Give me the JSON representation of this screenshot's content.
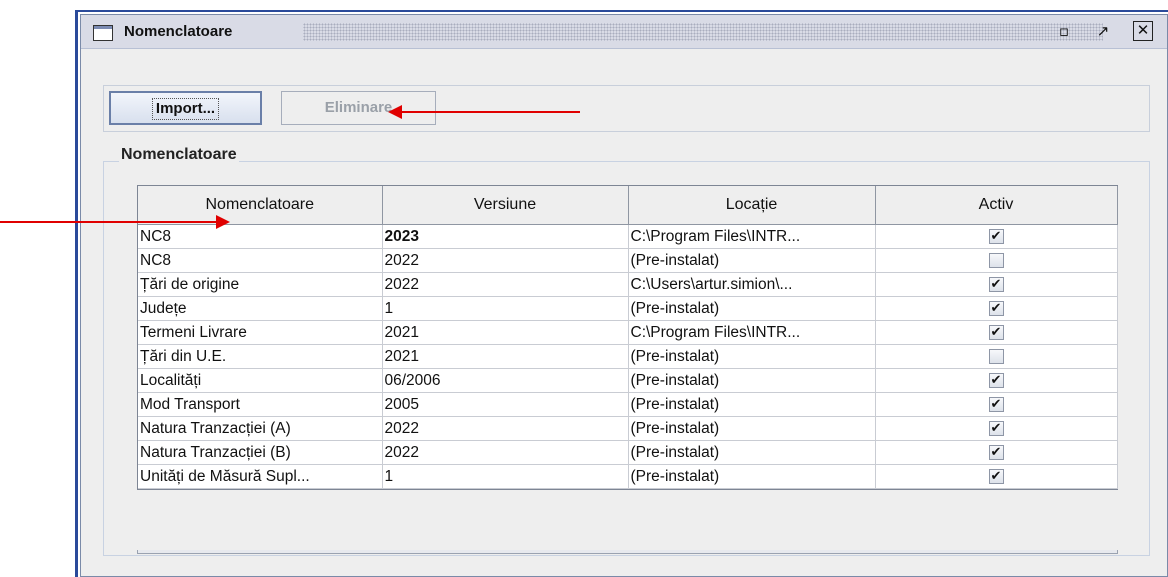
{
  "window": {
    "title": "Nomenclatoare",
    "controls": {
      "minimize": "▫",
      "maximize": "↗",
      "close": "✕"
    }
  },
  "toolbar": {
    "import_label": "Import...",
    "eliminare_label": "Eliminare"
  },
  "group": {
    "legend": "Nomenclatoare"
  },
  "table": {
    "columns": [
      "Nomenclatoare",
      "Versiune",
      "Locație",
      "Activ"
    ],
    "rows": [
      {
        "name": "NC8",
        "version": "2023",
        "location": "C:\\Program Files\\INTR...",
        "active": true
      },
      {
        "name": "NC8",
        "version": "2022",
        "location": "(Pre-instalat)",
        "active": false
      },
      {
        "name": "Țări de origine",
        "version": "2022",
        "location": "C:\\Users\\artur.simion\\...",
        "active": true
      },
      {
        "name": "Județe",
        "version": "1",
        "location": "(Pre-instalat)",
        "active": true
      },
      {
        "name": "Termeni Livrare",
        "version": "2021",
        "location": "C:\\Program Files\\INTR...",
        "active": true
      },
      {
        "name": "Țări din U.E.",
        "version": "2021",
        "location": "(Pre-instalat)",
        "active": false
      },
      {
        "name": "Localități",
        "version": "06/2006",
        "location": "(Pre-instalat)",
        "active": true
      },
      {
        "name": "Mod Transport",
        "version": "2005",
        "location": "(Pre-instalat)",
        "active": true
      },
      {
        "name": "Natura Tranzacției (A)",
        "version": "2022",
        "location": "(Pre-instalat)",
        "active": true
      },
      {
        "name": "Natura Tranzacției (B)",
        "version": "2022",
        "location": "(Pre-instalat)",
        "active": true
      },
      {
        "name": "Unități de Măsură Supl...",
        "version": "1",
        "location": "(Pre-instalat)",
        "active": true
      }
    ]
  },
  "colors": {
    "annotation_arrow": "#e00000",
    "title_bar": "#d9dbe6",
    "window_bg": "#eeeeee"
  },
  "icons": [
    "window-icon",
    "minimize-icon",
    "maximize-icon",
    "close-icon",
    "checkbox-icon",
    "arrow-annotation-icon"
  ]
}
